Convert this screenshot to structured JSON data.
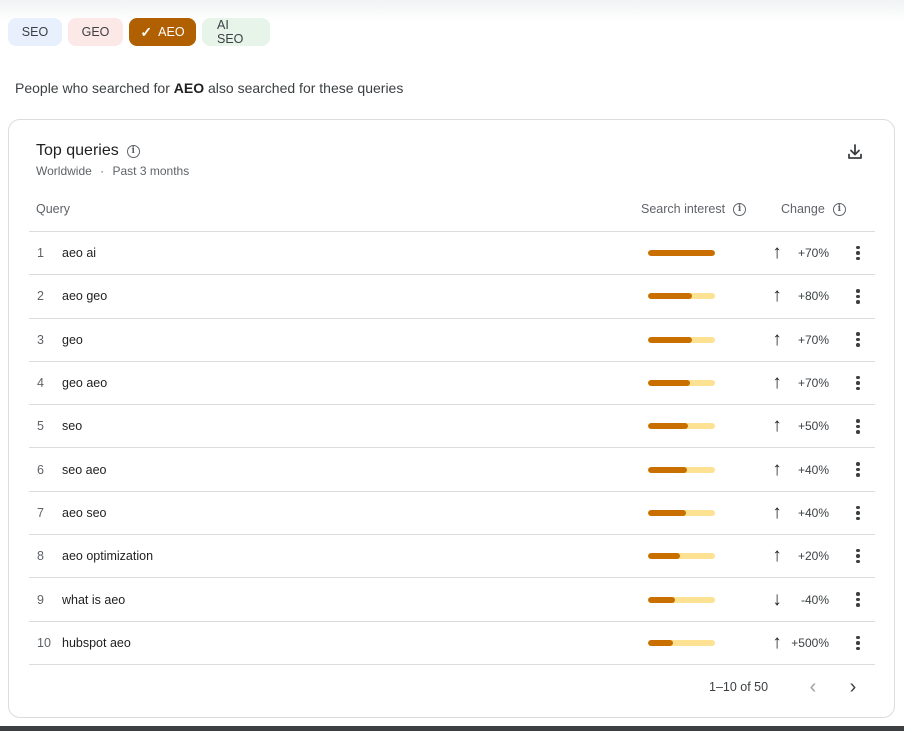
{
  "chips": [
    {
      "label": "SEO",
      "selected": false
    },
    {
      "label": "GEO",
      "selected": false
    },
    {
      "label": "AEO",
      "selected": true
    },
    {
      "label": "AI SEO",
      "selected": false
    }
  ],
  "intro": {
    "prefix": "People who searched for ",
    "term": "AEO",
    "suffix": " also searched for these queries"
  },
  "card": {
    "title": "Top queries",
    "region": "Worldwide",
    "separator": "·",
    "period": "Past 3 months",
    "download_icon": "download-icon"
  },
  "table": {
    "headers": {
      "query": "Query",
      "interest": "Search interest",
      "change": "Change"
    },
    "rows": [
      {
        "rank": "1",
        "query": "aeo ai",
        "interest": 100,
        "direction": "up",
        "change": "+70%"
      },
      {
        "rank": "2",
        "query": "aeo geo",
        "interest": 66,
        "direction": "up",
        "change": "+80%"
      },
      {
        "rank": "3",
        "query": "geo",
        "interest": 66,
        "direction": "up",
        "change": "+70%"
      },
      {
        "rank": "4",
        "query": "geo aeo",
        "interest": 63,
        "direction": "up",
        "change": "+70%"
      },
      {
        "rank": "5",
        "query": "seo",
        "interest": 60,
        "direction": "up",
        "change": "+50%"
      },
      {
        "rank": "6",
        "query": "seo aeo",
        "interest": 58,
        "direction": "up",
        "change": "+40%"
      },
      {
        "rank": "7",
        "query": "aeo seo",
        "interest": 57,
        "direction": "up",
        "change": "+40%"
      },
      {
        "rank": "8",
        "query": "aeo optimization",
        "interest": 48,
        "direction": "up",
        "change": "+20%"
      },
      {
        "rank": "9",
        "query": "what is aeo",
        "interest": 40,
        "direction": "down",
        "change": "-40%"
      },
      {
        "rank": "10",
        "query": "hubspot aeo",
        "interest": 37,
        "direction": "up",
        "change": "+500%"
      }
    ]
  },
  "pagination": {
    "range": "1–10 of 50"
  },
  "colors": {
    "accent": "#b06000",
    "bar_fill": "#c96f00",
    "bar_track": "#fde293"
  }
}
